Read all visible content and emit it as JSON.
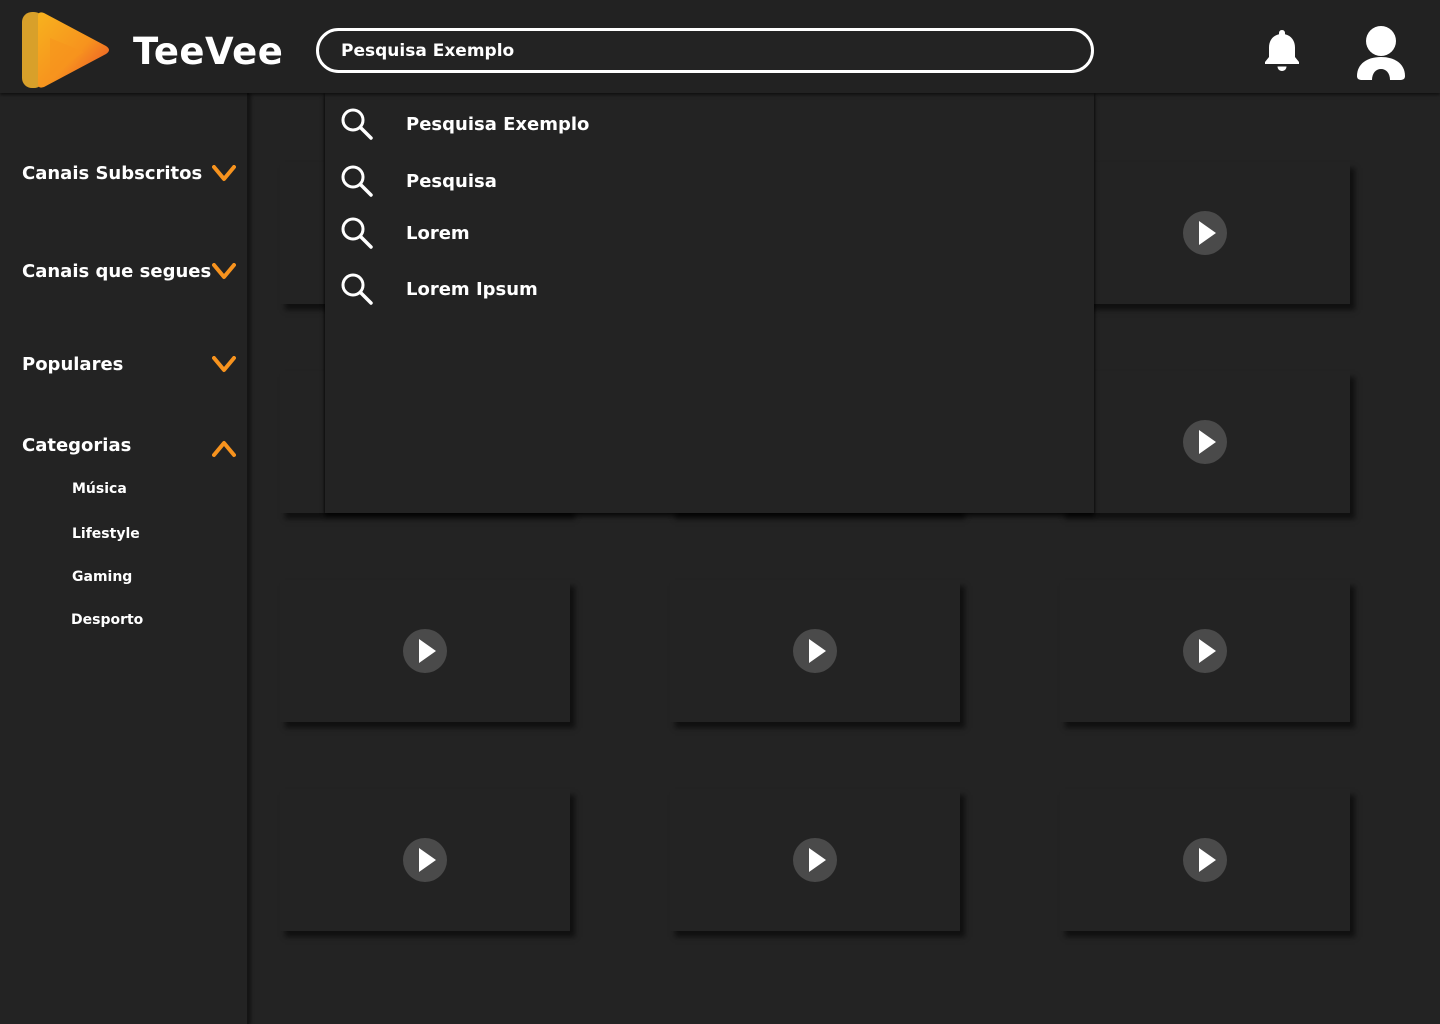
{
  "app": {
    "name": "TeeVee"
  },
  "colors": {
    "accent": "#F7931E",
    "accent_dark": "#E0A020",
    "logo_red": "#E8452C",
    "background": "#232323"
  },
  "header": {
    "search": {
      "value": "Pesquisa Exemplo"
    },
    "icons": {
      "notifications": "bell-icon",
      "profile": "user-icon"
    }
  },
  "search_suggestions": [
    {
      "label": "Pesquisa Exemplo",
      "icon": "search-icon"
    },
    {
      "label": "Pesquisa",
      "icon": "search-icon"
    },
    {
      "label": "Lorem",
      "icon": "search-icon"
    },
    {
      "label": "Lorem Ipsum",
      "icon": "search-icon"
    }
  ],
  "sidebar": {
    "sections": [
      {
        "label": "Canais Subscritos",
        "expanded": false,
        "icon": "chevron-down-icon"
      },
      {
        "label": "Canais que segues",
        "expanded": false,
        "icon": "chevron-down-icon"
      },
      {
        "label": "Populares",
        "expanded": false,
        "icon": "chevron-down-icon"
      },
      {
        "label": "Categorias",
        "expanded": true,
        "icon": "chevron-up-icon"
      }
    ],
    "categories": [
      "Música",
      "Lifestyle",
      "Gaming",
      "Desporto"
    ]
  },
  "video_grid": {
    "rows": 4,
    "columns": 3,
    "icon": "play-icon"
  }
}
